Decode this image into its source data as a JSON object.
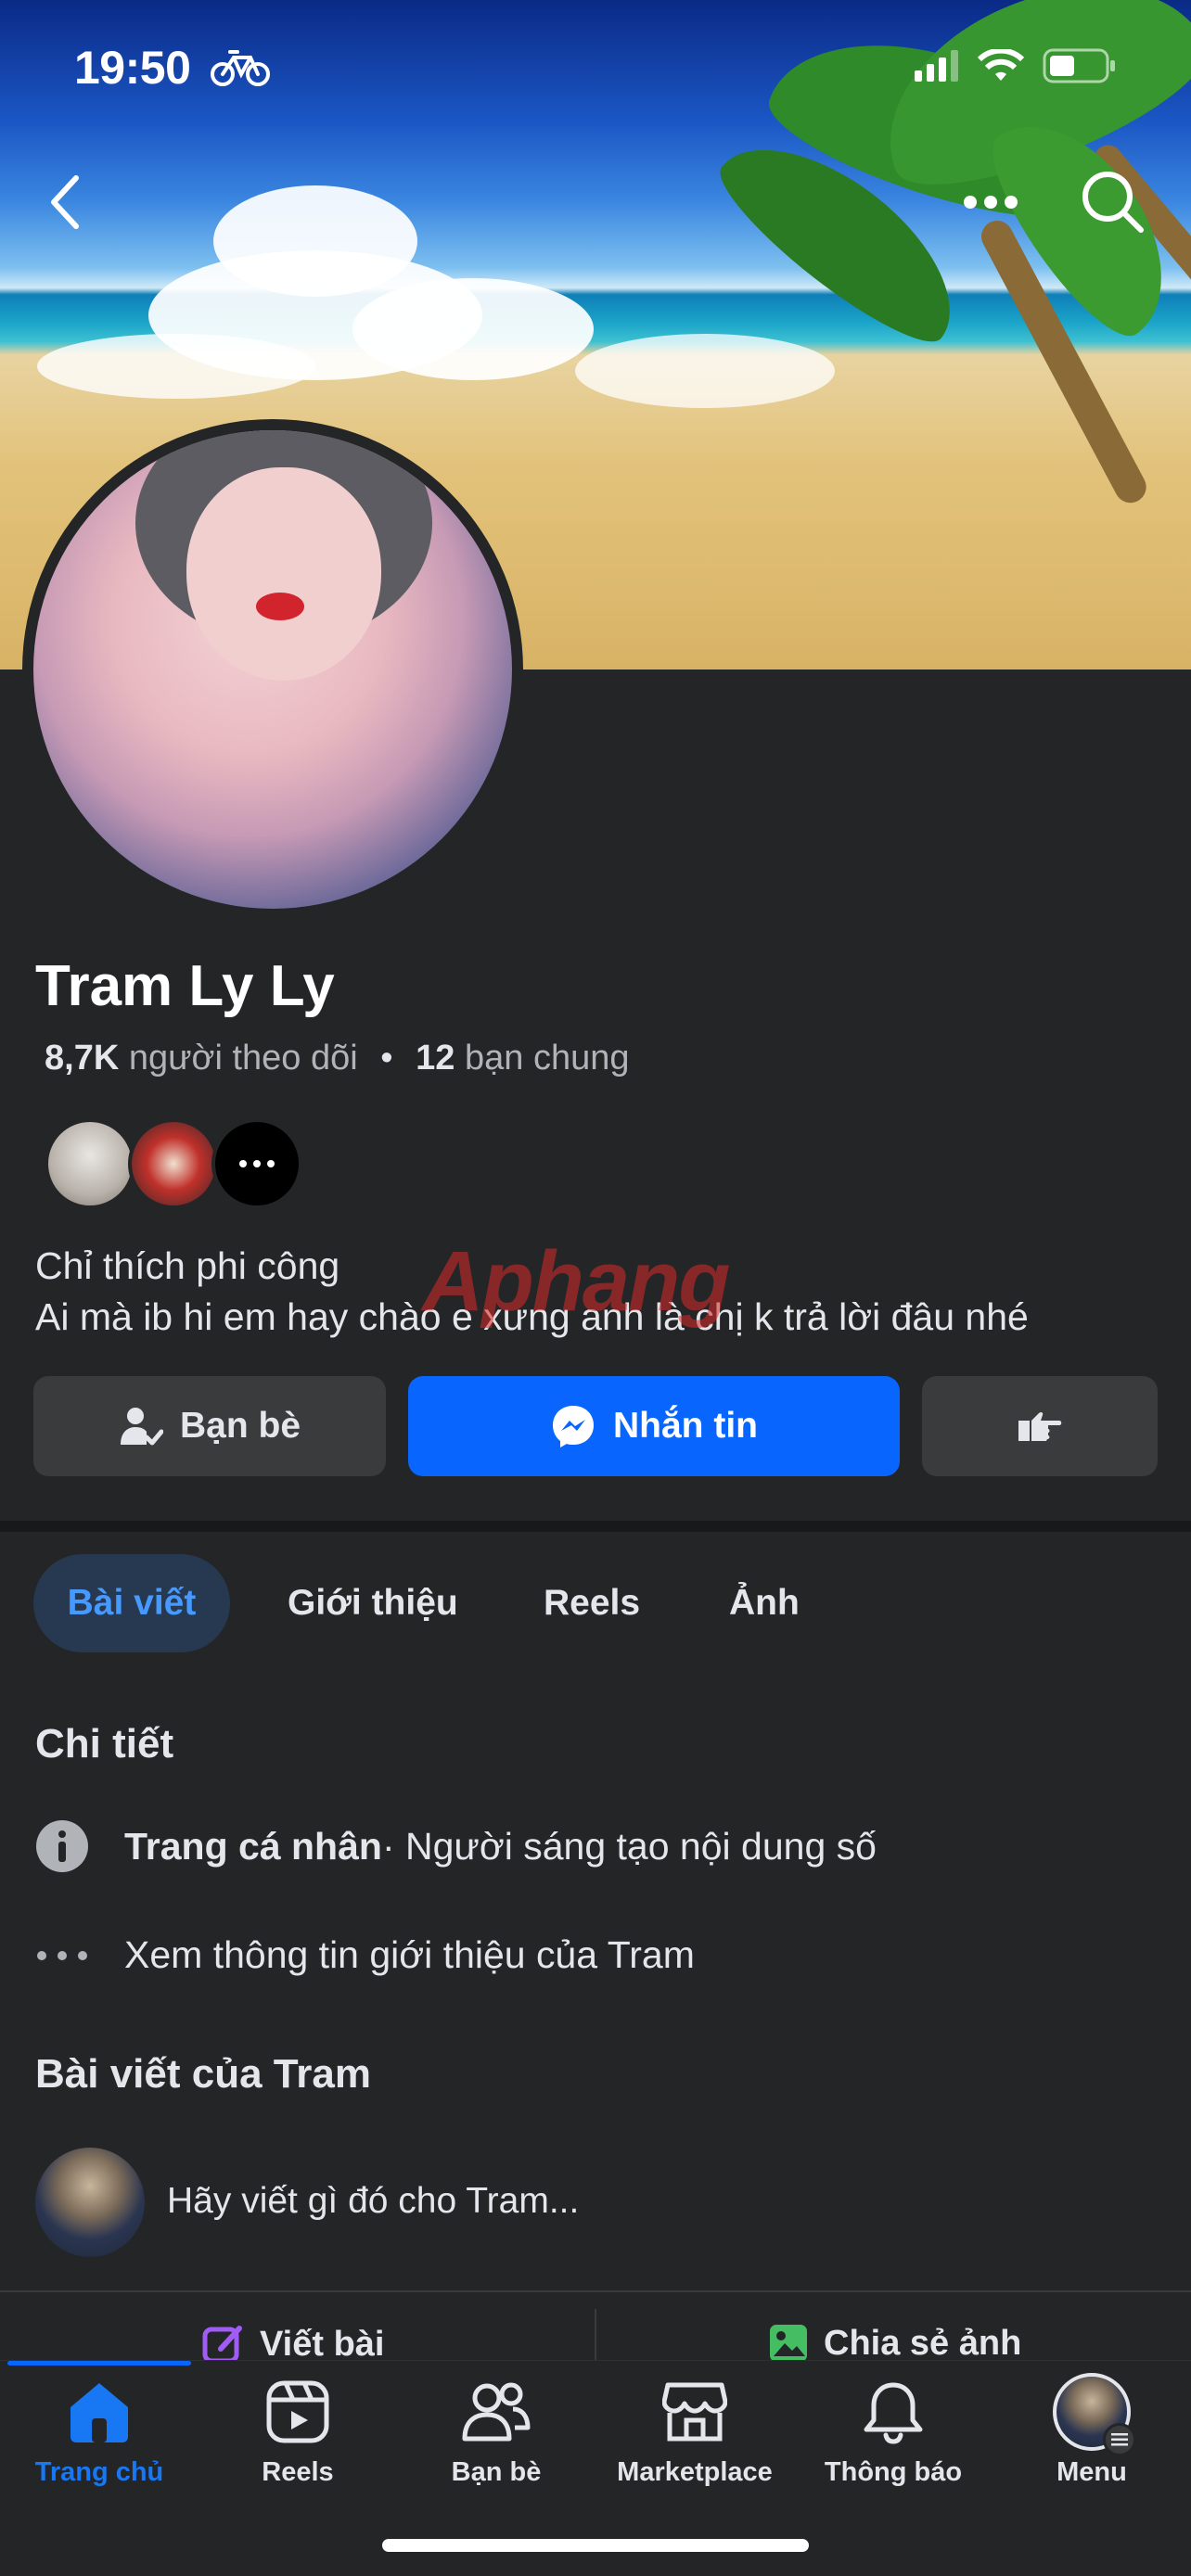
{
  "status_bar": {
    "time": "19:50"
  },
  "profile": {
    "name": "Tram Ly Ly",
    "followers_count": "8,7K",
    "followers_label": "người theo dõi",
    "separator": "•",
    "mutual_count": "12",
    "mutual_label": "bạn chung",
    "bio_line1": "Chỉ thích phi công",
    "bio_line2": "Ai mà ib hi em hay chào e xưng anh là chị k trả lời đâu nhé"
  },
  "watermark": "Aphang",
  "actions": {
    "friends_label": "Bạn bè",
    "message_label": "Nhắn tin"
  },
  "tabs": [
    {
      "label": "Bài viết"
    },
    {
      "label": "Giới thiệu"
    },
    {
      "label": "Reels"
    },
    {
      "label": "Ảnh"
    }
  ],
  "details": {
    "title": "Chi tiết",
    "page_type_bold": "Trang cá nhân",
    "page_type_rest": " · Người sáng tạo nội dung số",
    "see_about": "Xem thông tin giới thiệu của Tram"
  },
  "posts": {
    "title": "Bài viết của Tram",
    "composer_placeholder": "Hãy viết gì đó cho Tram...",
    "write_post": "Viết bài",
    "share_photo": "Chia sẻ ảnh"
  },
  "bottom_nav": [
    {
      "label": "Trang chủ",
      "active": true
    },
    {
      "label": "Reels"
    },
    {
      "label": "Bạn bè"
    },
    {
      "label": "Marketplace"
    },
    {
      "label": "Thông báo"
    },
    {
      "label": "Menu"
    }
  ],
  "colors": {
    "background": "#242526",
    "accent": "#0866ff",
    "active_tab_text": "#4599ff",
    "active_tab_bg": "#263951"
  }
}
